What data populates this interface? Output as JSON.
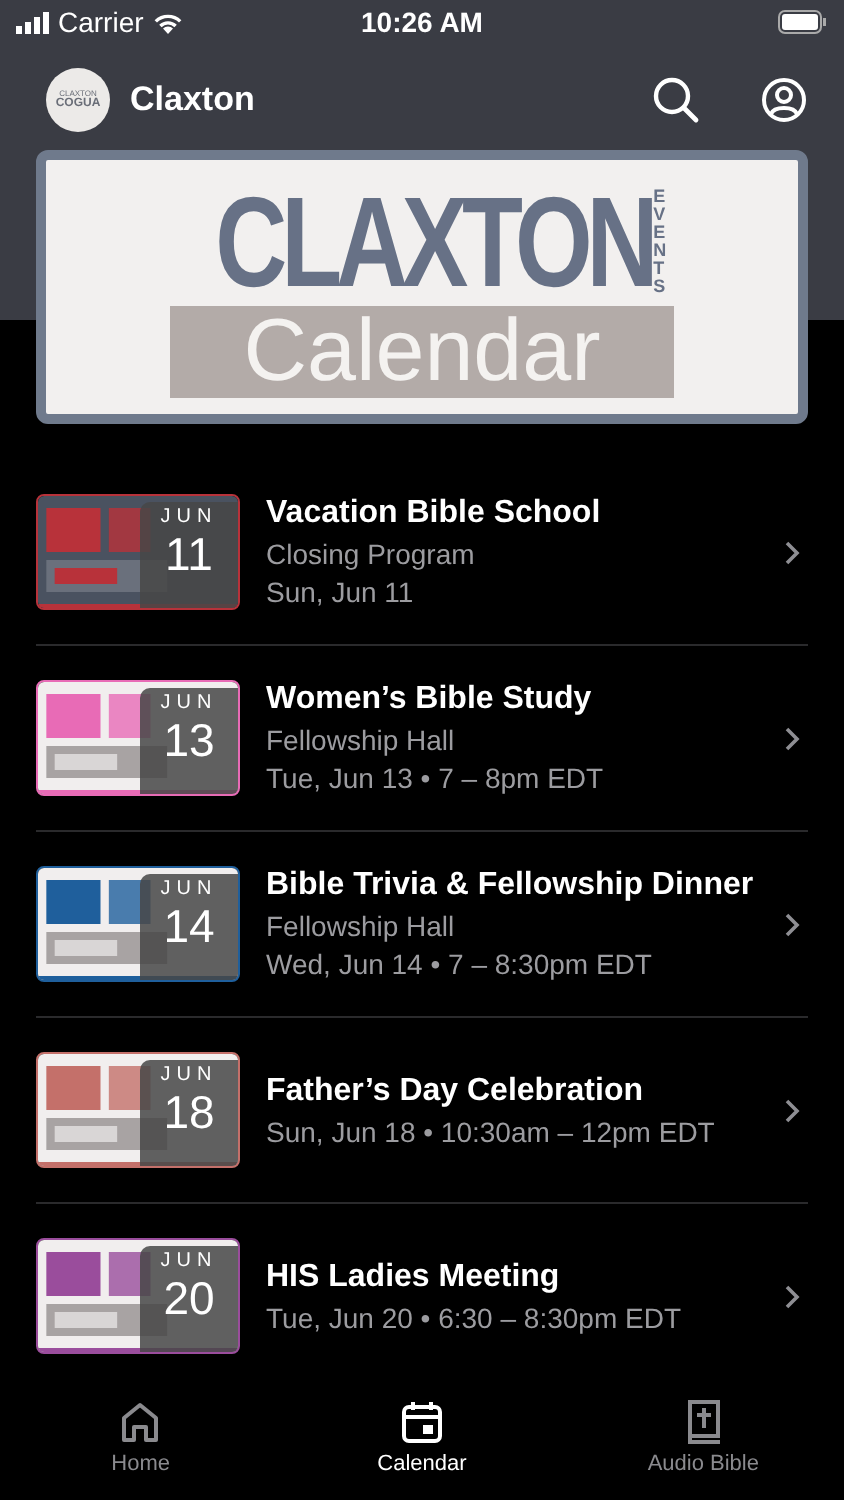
{
  "status_bar": {
    "carrier": "Carrier",
    "time": "10:26 AM"
  },
  "header": {
    "logo_lines": [
      "CLAXTON",
      "COGUA"
    ],
    "title": "Claxton"
  },
  "banner": {
    "title": "CLAXTON",
    "side": "EVENTS",
    "subtitle": "Calendar"
  },
  "events": [
    {
      "month": "JUN",
      "day": "11",
      "title": "Vacation Bible School",
      "lines": [
        "Closing Program",
        "Sun, Jun 11"
      ],
      "color": "#b8323a"
    },
    {
      "month": "JUN",
      "day": "13",
      "title": "Women’s Bible Study",
      "lines": [
        "Fellowship Hall",
        "Tue, Jun 13 • 7 – 8pm EDT"
      ],
      "color": "#e86bb6"
    },
    {
      "month": "JUN",
      "day": "14",
      "title": "Bible Trivia & Fellowship Dinner",
      "lines": [
        "Fellowship Hall",
        "Wed, Jun 14 • 7 – 8:30pm EDT"
      ],
      "color": "#1f5f9c"
    },
    {
      "month": "JUN",
      "day": "18",
      "title": "Father’s Day Celebration",
      "lines": [
        "Sun, Jun 18 • 10:30am – 12pm EDT"
      ],
      "color": "#c4706a"
    },
    {
      "month": "JUN",
      "day": "20",
      "title": "HIS Ladies Meeting",
      "lines": [
        "Tue, Jun 20 • 6:30 – 8:30pm EDT"
      ],
      "color": "#9a4d9c"
    }
  ],
  "tabs": [
    {
      "label": "Home",
      "kind": "home",
      "selected": false
    },
    {
      "label": "Calendar",
      "kind": "calendar",
      "selected": true
    },
    {
      "label": "Audio Bible",
      "kind": "bible",
      "selected": false
    }
  ]
}
